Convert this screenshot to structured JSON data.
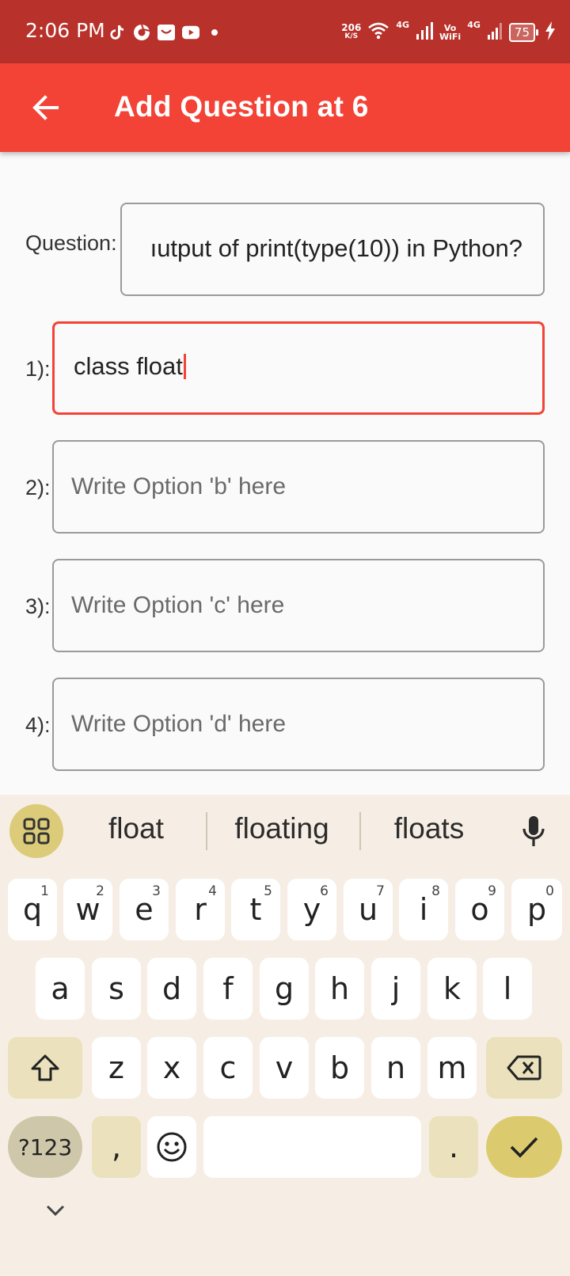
{
  "status_bar": {
    "time": "2:06 PM",
    "speed_value": "206",
    "speed_unit": "K/S",
    "net1": "4G",
    "volte_top": "Vo",
    "volte_bottom": "WiFi",
    "net2": "4G",
    "battery": "75",
    "icons_left": [
      "tiktok-icon",
      "chrome-like-icon",
      "mail-icon",
      "youtube-icon"
    ],
    "colors": {
      "background": "#b8312a"
    }
  },
  "app_bar": {
    "title": "Add Question at 6",
    "color": "#f34336"
  },
  "form": {
    "question_label": "Question:",
    "question_value": "ıutput of print(type(10)) in Python?",
    "options": [
      {
        "label": "1):",
        "value": "class float",
        "placeholder": ""
      },
      {
        "label": "2):",
        "value": "",
        "placeholder": "Write Option 'b' here"
      },
      {
        "label": "3):",
        "value": "",
        "placeholder": "Write Option 'c' here"
      },
      {
        "label": "4):",
        "value": "",
        "placeholder": "Write Option 'd' here"
      }
    ]
  },
  "keyboard": {
    "suggestions": [
      "float",
      "floating",
      "floats"
    ],
    "row1": [
      "q",
      "w",
      "e",
      "r",
      "t",
      "y",
      "u",
      "i",
      "o",
      "p"
    ],
    "row1_hints": [
      "1",
      "2",
      "3",
      "4",
      "5",
      "6",
      "7",
      "8",
      "9",
      "0"
    ],
    "row2": [
      "a",
      "s",
      "d",
      "f",
      "g",
      "h",
      "j",
      "k",
      "l"
    ],
    "row3": [
      "z",
      "x",
      "c",
      "v",
      "b",
      "n",
      "m"
    ],
    "symbols_label": "?123",
    "comma": ",",
    "period": ".",
    "colors": {
      "background": "#f6eee4",
      "accent": "#dccb6e",
      "modifier": "#ebe1bc"
    }
  }
}
